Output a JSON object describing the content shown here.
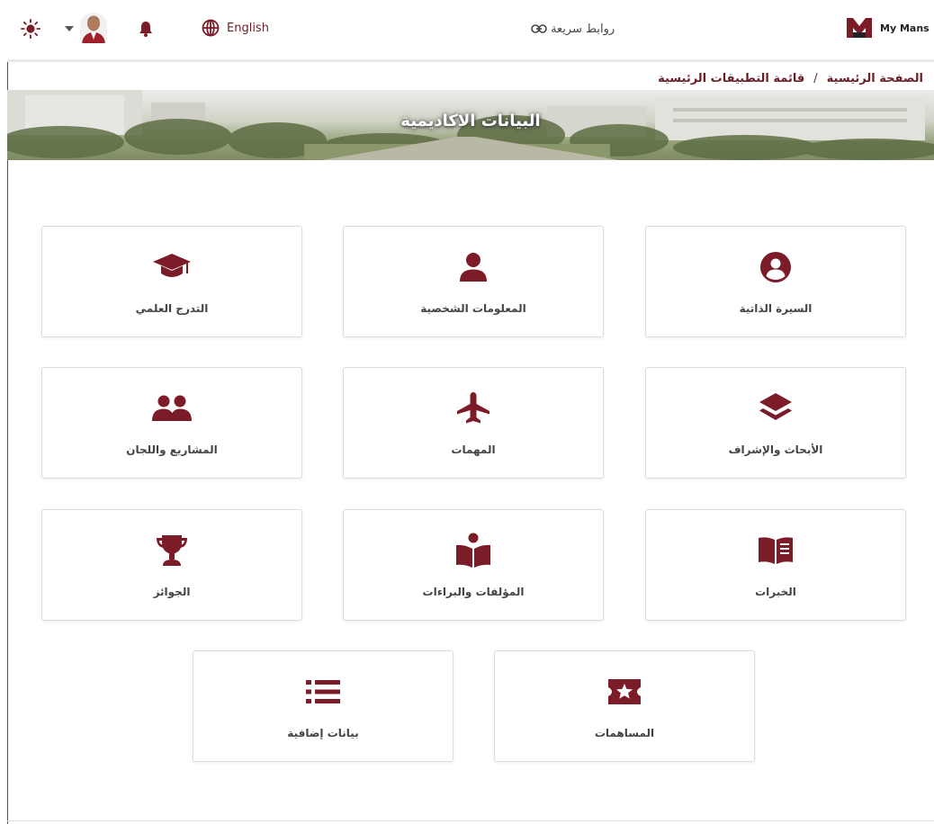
{
  "header": {
    "language_label": "English",
    "quick_links_label": "روابط سريعة",
    "brand_text": "My Mans"
  },
  "breadcrumb": {
    "home": "الصفحة الرئيسية",
    "separator": "/",
    "current": "قائمة التطبيقات الرئيسية"
  },
  "banner": {
    "title": "البيانات الاكاديمية"
  },
  "colors": {
    "accent": "#7b1c28",
    "icon": "#7b1c28",
    "text": "#444444",
    "border": "#dcdcdc"
  },
  "cards": [
    {
      "label": "السيرة الذاتية",
      "icon": "user-circle-icon"
    },
    {
      "label": "المعلومات الشخصية",
      "icon": "user-icon"
    },
    {
      "label": "التدرج العلمي",
      "icon": "graduation-cap-icon"
    },
    {
      "label": "الأبحاث والإشراف",
      "icon": "layers-icon"
    },
    {
      "label": "المهمات",
      "icon": "plane-icon"
    },
    {
      "label": "المشاريع واللجان",
      "icon": "users-icon"
    },
    {
      "label": "الخبرات",
      "icon": "book-open-icon"
    },
    {
      "label": "المؤلفات والبراءات",
      "icon": "reader-icon"
    },
    {
      "label": "الجوائز",
      "icon": "trophy-icon"
    },
    {
      "label": "المساهمات",
      "icon": "ticket-star-icon"
    },
    {
      "label": "بيانات إضافية",
      "icon": "list-icon"
    }
  ]
}
